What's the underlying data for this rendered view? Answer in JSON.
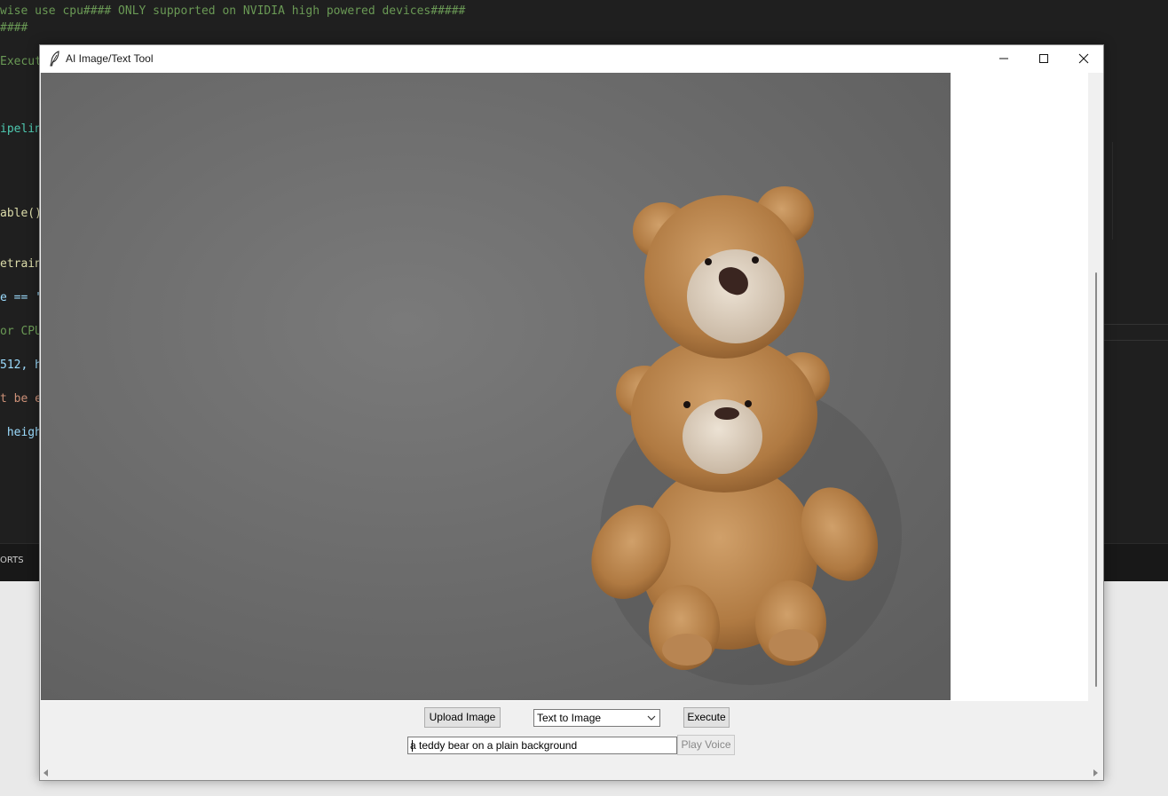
{
  "editor": {
    "lines": [
      {
        "text": "wise use cpu#### ONLY supported on NVIDIA high powered devices#####",
        "cls": "c-green"
      },
      {
        "text": "####",
        "cls": "c-green"
      },
      {
        "text": "Execut",
        "cls": "c-green"
      },
      {
        "text": "ipelin",
        "cls": "c-teal"
      },
      {
        "text": "able()",
        "cls": "c-yellow"
      },
      {
        "text": "etrain",
        "cls": "c-yellow"
      },
      {
        "text": "e == '",
        "cls": "c-blue"
      },
      {
        "text": "or CPU",
        "cls": "c-green"
      },
      {
        "text": "512, h",
        "cls": "c-blue"
      },
      {
        "text": "t be e",
        "cls": "c-orange"
      },
      {
        "text": " heigh",
        "cls": "c-blue"
      }
    ],
    "panel_label": "ORTS"
  },
  "window": {
    "title": "AI Image/Text Tool"
  },
  "controls": {
    "upload_label": "Upload Image",
    "mode_selected": "Text to Image",
    "execute_label": "Execute",
    "prompt_value": "a teddy bear on a plain background",
    "play_voice_label": "Play Voice"
  },
  "image": {
    "subject": "two stacked teddy bears on a gray background",
    "background_color": "#6f6f6f",
    "bear_color": "#b8834a"
  },
  "colors": {
    "editor_bg": "#1f1f1f",
    "window_bg": "#f0f0f0",
    "button_bg": "#e1e1e1"
  }
}
